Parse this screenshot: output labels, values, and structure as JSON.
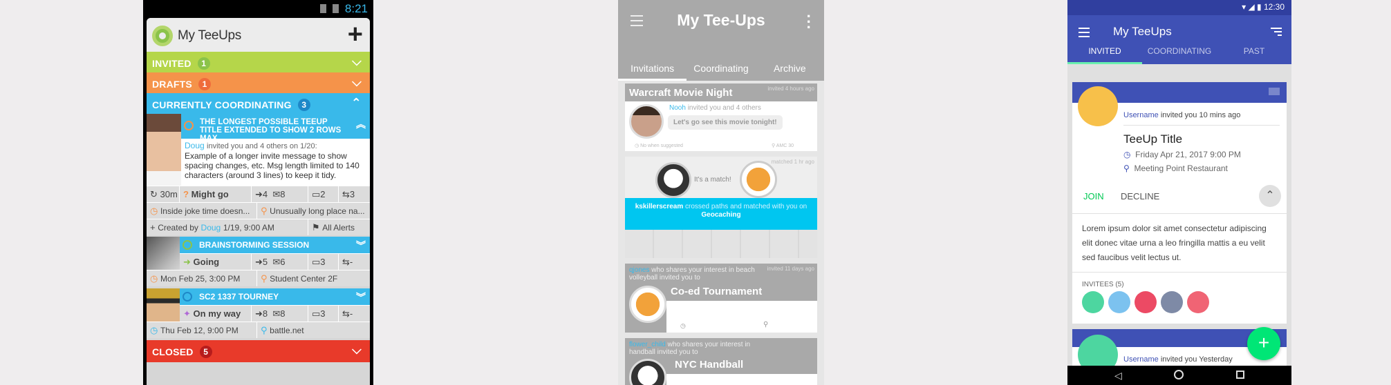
{
  "phone1": {
    "status_time": "8:21",
    "app_title": "My TeeUps",
    "sections": {
      "invited": {
        "label": "INVITED",
        "count": "1"
      },
      "drafts": {
        "label": "DRAFTS",
        "count": "1"
      },
      "coordinating": {
        "label": "CURRENTLY COORDINATING",
        "count": "3"
      },
      "closed": {
        "label": "CLOSED",
        "count": "5"
      }
    },
    "teeup1": {
      "title": "THE LONGEST POSSIBLE TEEUP TITLE EXTENDED TO SHOW 2 ROWS MAX",
      "inviter": "Doug",
      "invite_text": "invited you and 4 others on 1/20:",
      "message": "Example of a longer invite message to show spacing changes, etc. Msg length limited to 140 characters (around 3 lines) to keep it tidy.",
      "time": "30m",
      "status": "Might go",
      "going": "4",
      "mail": "8",
      "comments": "2",
      "shares": "3",
      "when": "Inside joke time doesn...",
      "where": "Unusually long place na...",
      "created_prefix": "Created by",
      "created_by": "Doug",
      "created_date": "1/19, 9:00 AM",
      "alerts": "All Alerts"
    },
    "teeup2": {
      "title": "BRAINSTORMING SESSION",
      "status": "Going",
      "going": "5",
      "mail": "6",
      "comments": "3",
      "shares": "-",
      "when": "Mon Feb 25, 3:00 PM",
      "where": "Student Center 2F"
    },
    "teeup3": {
      "title": "SC2 1337 TOURNEY",
      "status": "On my way",
      "going": "8",
      "mail": "8",
      "comments": "3",
      "shares": "-",
      "when": "Thu Feb 12, 9:00 PM",
      "where": "battle.net"
    }
  },
  "phone2": {
    "title": "My Tee-Ups",
    "tabs": [
      "Invitations",
      "Coordinating",
      "Archive"
    ],
    "card1": {
      "title": "Warcraft Movie Night",
      "meta": "invited 4 hours ago",
      "inviter": "Nooh",
      "invite_text": "invited you and 4 others",
      "message": "Let's go see this movie tonight!",
      "when": "No when suggested",
      "where": "AMC 30"
    },
    "card2": {
      "match": "It's a match!",
      "meta": "matched 1 hr ago",
      "user": "kskillerscream",
      "text": "crossed paths and matched with you on",
      "activity": "Geocaching"
    },
    "card3": {
      "user": "qjones",
      "text": "who shares your interest in beach volleyball invited you to",
      "meta": "invited 11 days ago",
      "title": "Co-ed Tournament"
    },
    "card4": {
      "user": "flower_child",
      "text": "who shares your interest in handball invited you to",
      "title": "NYC Handball"
    }
  },
  "phone3": {
    "status_time": "12:30",
    "title": "My TeeUps",
    "tabs": [
      "INVITED",
      "COORDINATING",
      "PAST"
    ],
    "card1": {
      "username": "Username",
      "invite_text": "invited you 10 mins ago",
      "title": "TeeUp Title",
      "datetime": "Friday Apr 21, 2017 9:00 PM",
      "place": "Meeting Point Restaurant",
      "join": "JOIN",
      "decline": "DECLINE",
      "body": "Lorem ipsum dolor sit amet consectetur adipiscing elit donec vitae urna a leo fringilla mattis a eu velit sed faucibus velit lectus ut.",
      "invitees_label": "INVITEES (5)"
    },
    "card2": {
      "username": "Username",
      "invite_text": "invited you Yesterday"
    },
    "colors": {
      "primary": "#3f51b5",
      "accent": "#00e676"
    }
  }
}
